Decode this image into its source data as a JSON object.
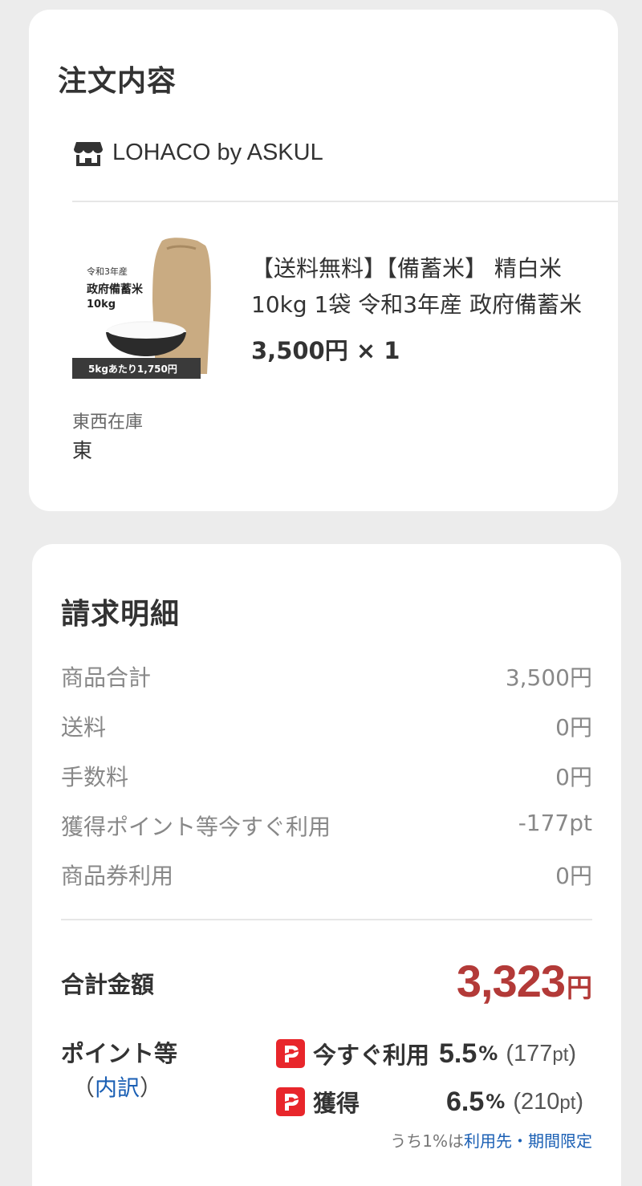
{
  "order": {
    "title": "注文内容",
    "shop_name": "LOHACO by ASKUL",
    "product": {
      "thumb_text_year": "令和3年産",
      "thumb_text_name": "政府備蓄米",
      "thumb_text_weight": "10kg",
      "thumb_text_badge": "5kgあたり1,750円",
      "name": "【送料無料】【備蓄米】 精白米 10kg 1袋 令和3年産 政府備蓄米",
      "price_line": "3,500円 × 1"
    },
    "option_label": "東西在庫",
    "option_value": "東"
  },
  "bill": {
    "title": "請求明細",
    "rows": [
      {
        "label": "商品合計",
        "value": "3,500円"
      },
      {
        "label": "送料",
        "value": "0円"
      },
      {
        "label": "手数料",
        "value": "0円"
      },
      {
        "label": "獲得ポイント等今すぐ利用",
        "value": "-177pt"
      },
      {
        "label": "商品券利用",
        "value": "0円"
      }
    ],
    "total_label": "合計金額",
    "total_value": "3,323",
    "total_unit": "円",
    "points_label": "ポイント等",
    "points_detail_open": "（",
    "points_detail_link": "内訳",
    "points_detail_close": "）",
    "use_now": {
      "name": "今すぐ利用",
      "rate": "5.5",
      "pct": "%",
      "paren_open": "(",
      "pt": "177",
      "pt_unit": "pt",
      "paren_close": ")"
    },
    "earn": {
      "name": "獲得",
      "rate": "6.5",
      "pct": "%",
      "paren_open": "(",
      "pt": "210",
      "pt_unit": "pt",
      "paren_close": ")"
    },
    "note_prefix": "うち1%は",
    "note_link": "利用先・期間限定"
  },
  "colors": {
    "accent_red": "#b33a38",
    "paypay_red": "#e8262b",
    "link_blue": "#1a5fb4"
  }
}
